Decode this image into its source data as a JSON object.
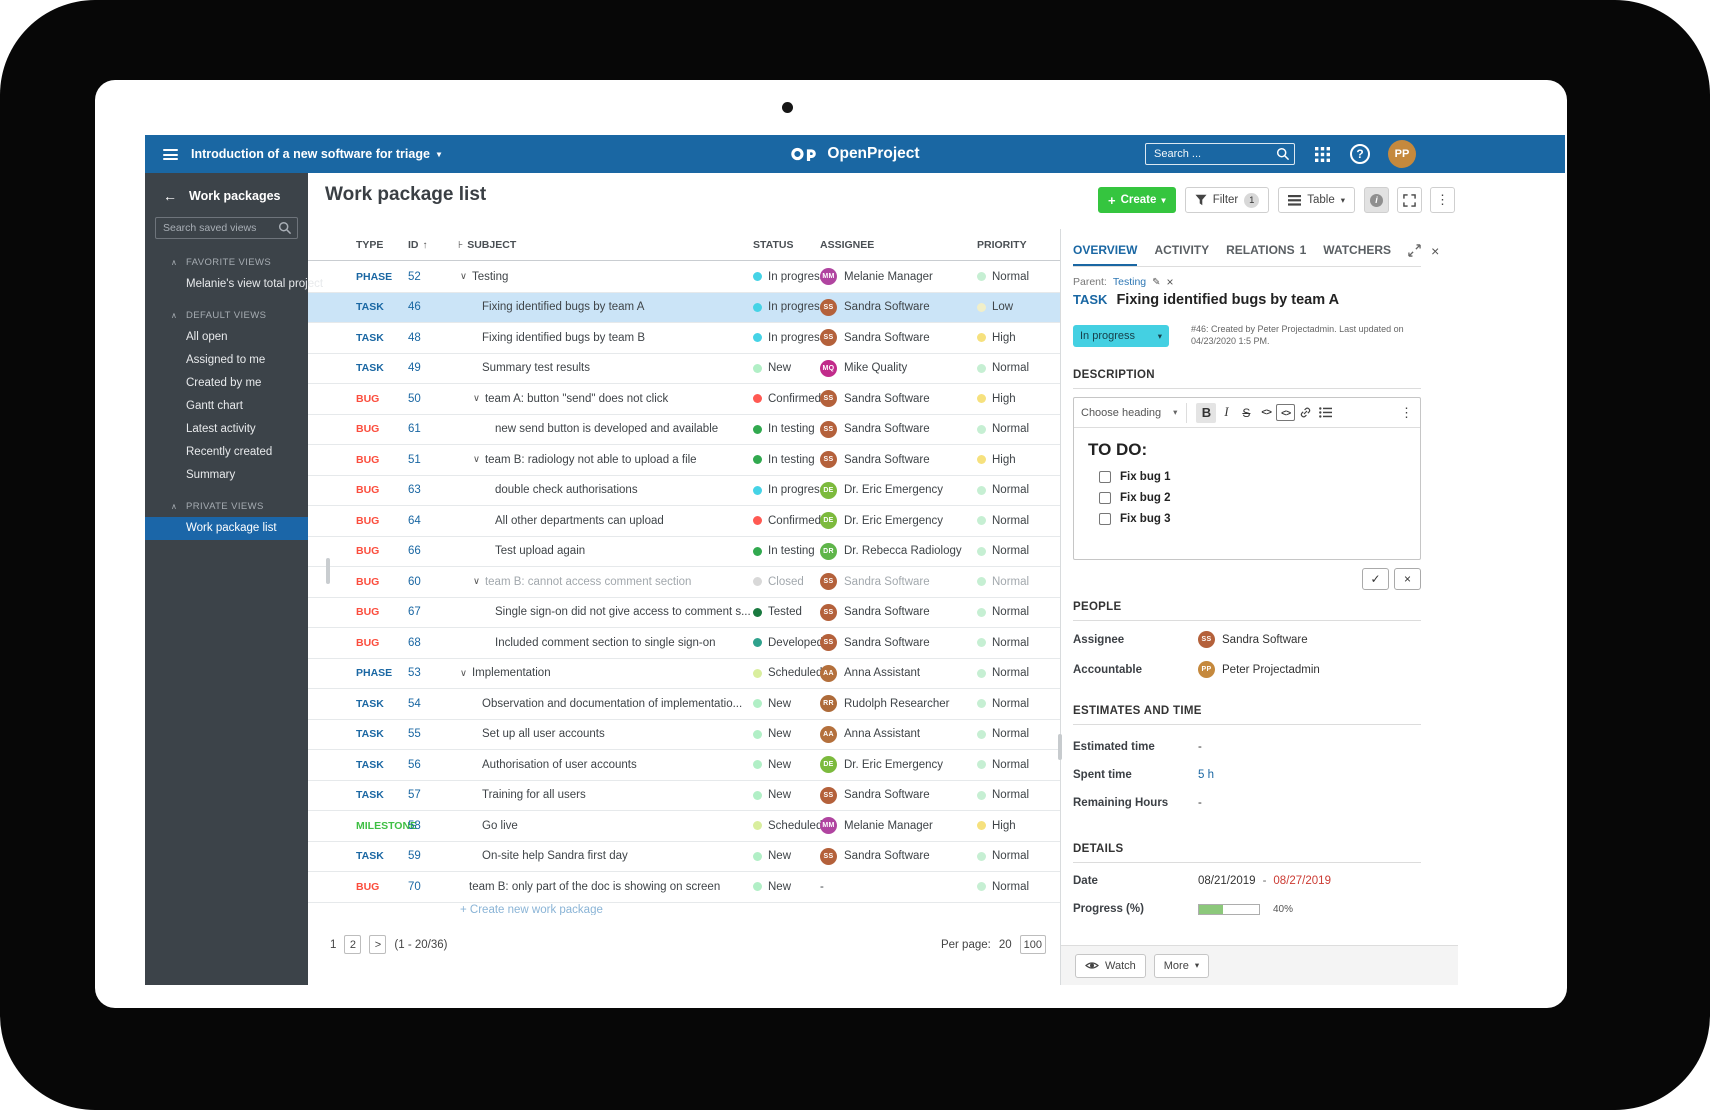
{
  "topbar": {
    "project": "Introduction of a new software for triage",
    "brand": "OpenProject",
    "search_placeholder": "Search ...",
    "user_initials": "PP"
  },
  "sidebar": {
    "title": "Work packages",
    "search_placeholder": "Search saved views",
    "sections": [
      {
        "label": "FAVORITE VIEWS",
        "items": [
          {
            "label": "Melanie's view total project",
            "selected": false
          }
        ]
      },
      {
        "label": "DEFAULT VIEWS",
        "items": [
          {
            "label": "All open",
            "selected": false
          },
          {
            "label": "Assigned to me",
            "selected": false
          },
          {
            "label": "Created by me",
            "selected": false
          },
          {
            "label": "Gantt chart",
            "selected": false
          },
          {
            "label": "Latest activity",
            "selected": false
          },
          {
            "label": "Recently created",
            "selected": false
          },
          {
            "label": "Summary",
            "selected": false
          }
        ]
      },
      {
        "label": "PRIVATE VIEWS",
        "items": [
          {
            "label": "Work package list",
            "selected": true
          }
        ]
      }
    ]
  },
  "main": {
    "title": "Work package list"
  },
  "toolbar": {
    "create": "Create",
    "filter": "Filter",
    "filter_count": "1",
    "table": "Table"
  },
  "table": {
    "headers": {
      "type": "TYPE",
      "id": "ID",
      "subject": "SUBJECT",
      "status": "STATUS",
      "assignee": "ASSIGNEE",
      "priority": "PRIORITY"
    },
    "rows": [
      {
        "type": "PHASE",
        "id": "52",
        "subject": "Testing",
        "indent": 0,
        "expanded": true,
        "status": "In progress",
        "assignee_initials": "MM",
        "assignee": "Melanie Manager",
        "priority": "Normal",
        "selected": false,
        "muted": false
      },
      {
        "type": "TASK",
        "id": "46",
        "subject": "Fixing identified bugs by team A",
        "indent": 1,
        "expanded": false,
        "status": "In progress",
        "assignee_initials": "SS",
        "assignee": "Sandra Software",
        "priority": "Low",
        "selected": true,
        "muted": false
      },
      {
        "type": "TASK",
        "id": "48",
        "subject": "Fixing identified bugs by team B",
        "indent": 1,
        "expanded": false,
        "status": "In progress",
        "assignee_initials": "SS",
        "assignee": "Sandra Software",
        "priority": "High",
        "selected": false,
        "muted": false
      },
      {
        "type": "TASK",
        "id": "49",
        "subject": "Summary test results",
        "indent": 1,
        "expanded": false,
        "status": "New",
        "assignee_initials": "MQ",
        "assignee": "Mike Quality",
        "priority": "Normal",
        "selected": false,
        "muted": false
      },
      {
        "type": "BUG",
        "id": "50",
        "subject": "team A: button \"send\" does not click",
        "indent": 1,
        "expanded": true,
        "status": "Confirmed",
        "assignee_initials": "SS",
        "assignee": "Sandra Software",
        "priority": "High",
        "selected": false,
        "muted": false
      },
      {
        "type": "BUG",
        "id": "61",
        "subject": "new send button is developed and available",
        "indent": 2,
        "expanded": false,
        "status": "In testing",
        "assignee_initials": "SS",
        "assignee": "Sandra Software",
        "priority": "Normal",
        "selected": false,
        "muted": false
      },
      {
        "type": "BUG",
        "id": "51",
        "subject": "team B: radiology not able to upload a file",
        "indent": 1,
        "expanded": true,
        "status": "In testing",
        "assignee_initials": "SS",
        "assignee": "Sandra Software",
        "priority": "High",
        "selected": false,
        "muted": false
      },
      {
        "type": "BUG",
        "id": "63",
        "subject": "double check authorisations",
        "indent": 2,
        "expanded": false,
        "status": "In progress",
        "assignee_initials": "DE",
        "assignee": "Dr. Eric Emergency",
        "priority": "Normal",
        "selected": false,
        "muted": false
      },
      {
        "type": "BUG",
        "id": "64",
        "subject": "All other departments can upload",
        "indent": 2,
        "expanded": false,
        "status": "Confirmed",
        "assignee_initials": "DE",
        "assignee": "Dr. Eric Emergency",
        "priority": "Normal",
        "selected": false,
        "muted": false
      },
      {
        "type": "BUG",
        "id": "66",
        "subject": "Test upload again",
        "indent": 2,
        "expanded": false,
        "status": "In testing",
        "assignee_initials": "DR",
        "assignee": "Dr. Rebecca Radiology",
        "priority": "Normal",
        "selected": false,
        "muted": false
      },
      {
        "type": "BUG",
        "id": "60",
        "subject": "team B: cannot access comment section",
        "indent": 1,
        "expanded": true,
        "status": "Closed",
        "assignee_initials": "SS",
        "assignee": "Sandra Software",
        "priority": "Normal",
        "selected": false,
        "muted": true
      },
      {
        "type": "BUG",
        "id": "67",
        "subject": "Single sign-on did not give access to comment s...",
        "indent": 2,
        "expanded": false,
        "status": "Tested",
        "assignee_initials": "SS",
        "assignee": "Sandra Software",
        "priority": "Normal",
        "selected": false,
        "muted": false
      },
      {
        "type": "BUG",
        "id": "68",
        "subject": "Included comment section to single sign-on",
        "indent": 2,
        "expanded": false,
        "status": "Developed",
        "assignee_initials": "SS",
        "assignee": "Sandra Software",
        "priority": "Normal",
        "selected": false,
        "muted": false
      },
      {
        "type": "PHASE",
        "id": "53",
        "subject": "Implementation",
        "indent": 0,
        "expanded": true,
        "status": "Scheduled",
        "assignee_initials": "AA",
        "assignee": "Anna Assistant",
        "priority": "Normal",
        "selected": false,
        "muted": false
      },
      {
        "type": "TASK",
        "id": "54",
        "subject": "Observation and documentation of implementatio...",
        "indent": 1,
        "expanded": false,
        "status": "New",
        "assignee_initials": "RR",
        "assignee": "Rudolph Researcher",
        "priority": "Normal",
        "selected": false,
        "muted": false
      },
      {
        "type": "TASK",
        "id": "55",
        "subject": "Set up all user accounts",
        "indent": 1,
        "expanded": false,
        "status": "New",
        "assignee_initials": "AA",
        "assignee": "Anna Assistant",
        "priority": "Normal",
        "selected": false,
        "muted": false
      },
      {
        "type": "TASK",
        "id": "56",
        "subject": "Authorisation of user accounts",
        "indent": 1,
        "expanded": false,
        "status": "New",
        "assignee_initials": "DE",
        "assignee": "Dr. Eric Emergency",
        "priority": "Normal",
        "selected": false,
        "muted": false
      },
      {
        "type": "TASK",
        "id": "57",
        "subject": "Training for all users",
        "indent": 1,
        "expanded": false,
        "status": "New",
        "assignee_initials": "SS",
        "assignee": "Sandra Software",
        "priority": "Normal",
        "selected": false,
        "muted": false
      },
      {
        "type": "MILESTONE",
        "id": "58",
        "subject": "Go live",
        "indent": 1,
        "expanded": false,
        "status": "Scheduled",
        "assignee_initials": "MM",
        "assignee": "Melanie Manager",
        "priority": "High",
        "selected": false,
        "muted": false
      },
      {
        "type": "TASK",
        "id": "59",
        "subject": "On-site help Sandra first day",
        "indent": 1,
        "expanded": false,
        "status": "New",
        "assignee_initials": "SS",
        "assignee": "Sandra Software",
        "priority": "Normal",
        "selected": false,
        "muted": false
      },
      {
        "type": "BUG",
        "id": "70",
        "subject": "team B: only part of the doc is showing on screen",
        "indent": 0,
        "expanded": false,
        "status": "New",
        "assignee_initials": null,
        "assignee": "-",
        "priority": "Normal",
        "selected": false,
        "muted": false
      }
    ]
  },
  "pagination": {
    "current": "1",
    "second": "2",
    "next": ">",
    "range": "(1 - 20/36)",
    "per_page_label": "Per page:",
    "per_page_current": "20",
    "per_page_alt": "100",
    "create_label": "+ Create new work package"
  },
  "panel": {
    "tabs": [
      {
        "label": "OVERVIEW",
        "active": true
      },
      {
        "label": "ACTIVITY",
        "active": false
      },
      {
        "label": "RELATIONS",
        "active": false,
        "badge": "1"
      },
      {
        "label": "WATCHERS",
        "active": false
      }
    ],
    "parent": {
      "label": "Parent:",
      "link": "Testing"
    },
    "wp_type": "TASK",
    "wp_title": "Fixing identified bugs by team A",
    "status_chip": "In progress",
    "meta_text": "#46: Created by Peter Projectadmin. Last updated on 04/23/2020 1:5 PM.",
    "description": {
      "header": "DESCRIPTION",
      "choose_heading": "Choose heading",
      "todo_heading": "TO DO:",
      "todos": [
        "Fix bug 1",
        "Fix bug 2",
        "Fix bug 3"
      ]
    },
    "people": {
      "header": "PEOPLE",
      "rows": [
        {
          "label": "Assignee",
          "initials": "SS",
          "name": "Sandra Software"
        },
        {
          "label": "Accountable",
          "initials": "PP",
          "name": "Peter Projectadmin"
        }
      ]
    },
    "estimates": {
      "header": "ESTIMATES AND TIME",
      "rows": [
        {
          "label": "Estimated time",
          "value": "-",
          "link": false
        },
        {
          "label": "Spent time",
          "value": "5 h",
          "link": true
        },
        {
          "label": "Remaining Hours",
          "value": "-",
          "link": false
        }
      ]
    },
    "details": {
      "header": "DETAILS",
      "date_label": "Date",
      "date_start": "08/21/2019",
      "date_sep": "-",
      "date_end": "08/27/2019",
      "progress_label": "Progress (%)",
      "progress_text": "40%",
      "progress_pct": 40
    },
    "footer": {
      "watch": "Watch",
      "more": "More"
    }
  },
  "icons": {
    "caret_down": "▾",
    "back_arrow": "←",
    "sort_asc": "↑",
    "hierarchy": "⊦",
    "expand_chevron": "∨",
    "section_chevron": "∧",
    "kebab": "⋮",
    "plus": "+",
    "question": "?",
    "close": "×",
    "pencil": "✎",
    "check": "✓",
    "info": "i",
    "bold": "B",
    "italic": "I",
    "strike": "S",
    "code": "<>",
    "codeblock": "<>"
  },
  "colors": {
    "topbar_blue": "#1A67A3",
    "create_green": "#35C53F",
    "selected_row_bg": "#CBE4F7",
    "sidebar_bg": "#3C4349",
    "sidebar_selected_bg": "#1B66A8",
    "chip_bg": "#44D0E2",
    "date_red": "#CC3B33",
    "progress_fill": "#8CC87B",
    "type": {
      "PHASE": "#1A67A3",
      "TASK": "#1A67A3",
      "BUG": "#FB4D3D",
      "MILESTONE": "#3FBF44"
    },
    "status": {
      "In progress": "#45D3E6",
      "New": "#B1EFC6",
      "Confirmed": "#FF5952",
      "In testing": "#31A94F",
      "Closed": "#D8D8D8",
      "Tested": "#19793F",
      "Developed": "#2FA18C",
      "Scheduled": "#D9EE9E"
    },
    "priority": {
      "Normal": "#C6EFD3",
      "Low": "#F1EFC9",
      "High": "#F6E17E"
    },
    "avatars": {
      "MM": "#B044A0",
      "SS": "#B4613B",
      "MQ": "#C12B8B",
      "DE": "#7CBA3D",
      "DR": "#5FB54A",
      "AA": "#B4703C",
      "RR": "#AE6B3A",
      "PP": "#C5893D"
    }
  }
}
